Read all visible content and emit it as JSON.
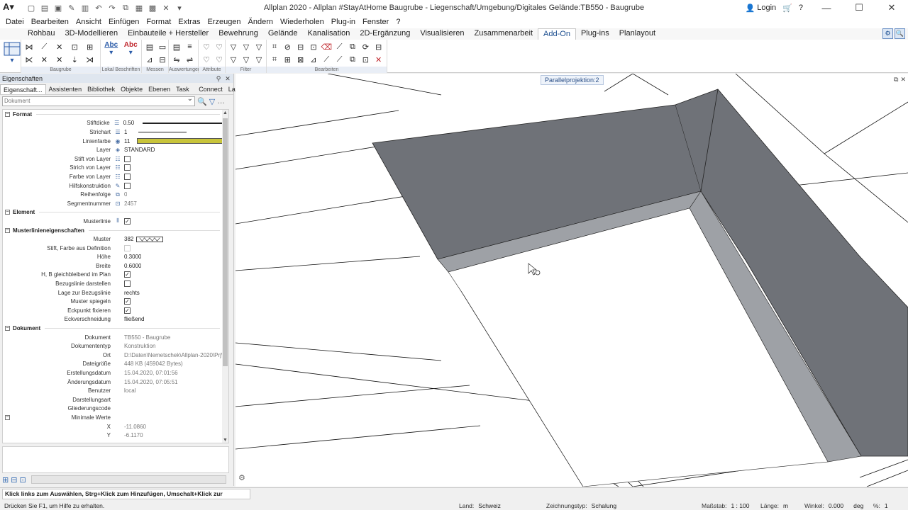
{
  "window": {
    "title": "Allplan 2020 - Allplan #StayAtHome Baugrube - Liegenschaft/Umgebung/Digitales Gelände:TB550 - Baugrube",
    "login_label": "Login"
  },
  "menu": [
    "Datei",
    "Bearbeiten",
    "Ansicht",
    "Einfügen",
    "Format",
    "Extras",
    "Erzeugen",
    "Ändern",
    "Wiederholen",
    "Plug-in",
    "Fenster",
    "?"
  ],
  "ribbon_tabs": [
    {
      "label": "Rohbau"
    },
    {
      "label": "3D-Modellieren"
    },
    {
      "label": "Einbauteile + Hersteller"
    },
    {
      "label": "Bewehrung"
    },
    {
      "label": "Gelände"
    },
    {
      "label": "Kanalisation"
    },
    {
      "label": "2D-Ergänzung"
    },
    {
      "label": "Visualisieren"
    },
    {
      "label": "Zusammenarbeit"
    },
    {
      "label": "Add-On",
      "active": true
    },
    {
      "label": "Plug-ins"
    },
    {
      "label": "Planlayout"
    }
  ],
  "ribbon_groups": [
    "Baugrube",
    "Lokal Beschriften",
    "Messen",
    "Auswertungen",
    "Attribute",
    "Filter",
    "Bearbeiten"
  ],
  "ribbon_small_labels": {
    "abc1": "Abc",
    "abc2": "Abc"
  },
  "panel": {
    "title": "Eigenschaften",
    "tabs": [
      "Eigenschaft...",
      "Assistenten",
      "Bibliothek",
      "Objekte",
      "Ebenen",
      "Task Board",
      "Connect",
      "Layer"
    ],
    "document_select": "Dokument",
    "sections": {
      "format": "Format",
      "element": "Element",
      "muster": "Musterlinieneigenschaften",
      "dokument": "Dokument"
    },
    "format_rows": [
      {
        "label": "Stiftdicke",
        "value": "0.50"
      },
      {
        "label": "Strichart",
        "value": "1"
      },
      {
        "label": "Linienfarbe",
        "value": "11"
      },
      {
        "label": "Layer",
        "value": "STANDARD"
      },
      {
        "label": "Stift von Layer"
      },
      {
        "label": "Strich von Layer"
      },
      {
        "label": "Farbe von Layer"
      },
      {
        "label": "Hilfskonstruktion"
      },
      {
        "label": "Reihenfolge",
        "value": "0"
      },
      {
        "label": "Segmentnummer",
        "value": "2457"
      }
    ],
    "element_rows": [
      {
        "label": "Musterlinie"
      }
    ],
    "muster_rows": [
      {
        "label": "Muster",
        "value": "382"
      },
      {
        "label": "Stift, Farbe aus Definition"
      },
      {
        "label": "Höhe",
        "value": "0.3000"
      },
      {
        "label": "Breite",
        "value": "0.6000"
      },
      {
        "label": "H, B gleichbleibend im Plan"
      },
      {
        "label": "Bezugslinie darstellen"
      },
      {
        "label": "Lage zur Bezugslinie",
        "value": "rechts"
      },
      {
        "label": "Muster spiegeln"
      },
      {
        "label": "Eckpunkt fixieren"
      },
      {
        "label": "Eckverschneidung",
        "value": "fließend"
      }
    ],
    "dokument_rows": [
      {
        "label": "Dokument",
        "value": "TB550 - Baugrube"
      },
      {
        "label": "Dokumententyp",
        "value": "Konstruktion"
      },
      {
        "label": "Ort",
        "value": "D:\\Daten\\Nemetschek\\Allplan-2020\\Prj\\A"
      },
      {
        "label": "Dateigröße",
        "value": "448 KB (459042 Bytes)"
      },
      {
        "label": "Erstellungsdatum",
        "value": "15.04.2020, 07:01:56"
      },
      {
        "label": "Änderungsdatum",
        "value": "15.04.2020, 07:05:51"
      },
      {
        "label": "Benutzer",
        "value": "local"
      },
      {
        "label": "Darstellungsart",
        "value": ""
      },
      {
        "label": "Gliederungscode",
        "value": ""
      },
      {
        "label": "Minimale Werte",
        "value": ""
      },
      {
        "label": "X",
        "value": "-11.0860"
      },
      {
        "label": "Y",
        "value": "-6.1170"
      }
    ]
  },
  "viewport": {
    "label": "Parallelprojektion:2"
  },
  "status": {
    "hint": "Klick links zum Auswählen, Strg+Klick zum Hinzufügen, Umschalt+Klick zur Segmentwahl",
    "help": "Drücken Sie F1, um Hilfe zu erhalten.",
    "land_key": "Land:",
    "land_val": "Schweiz",
    "zt_key": "Zeichnungstyp:",
    "zt_val": "Schalung",
    "ms_key": "Maßstab:",
    "ms_val": "1 : 100",
    "len_key": "Länge:",
    "len_val": "m",
    "win_key": "Winkel:",
    "win_val": "0.000",
    "win_unit": "deg",
    "pct_key": "%:",
    "pct_val": "1"
  },
  "colors": {
    "wall_dark": "#6f7278",
    "wall_light": "#9ea1a6",
    "linecolor": "#c8c43a"
  }
}
